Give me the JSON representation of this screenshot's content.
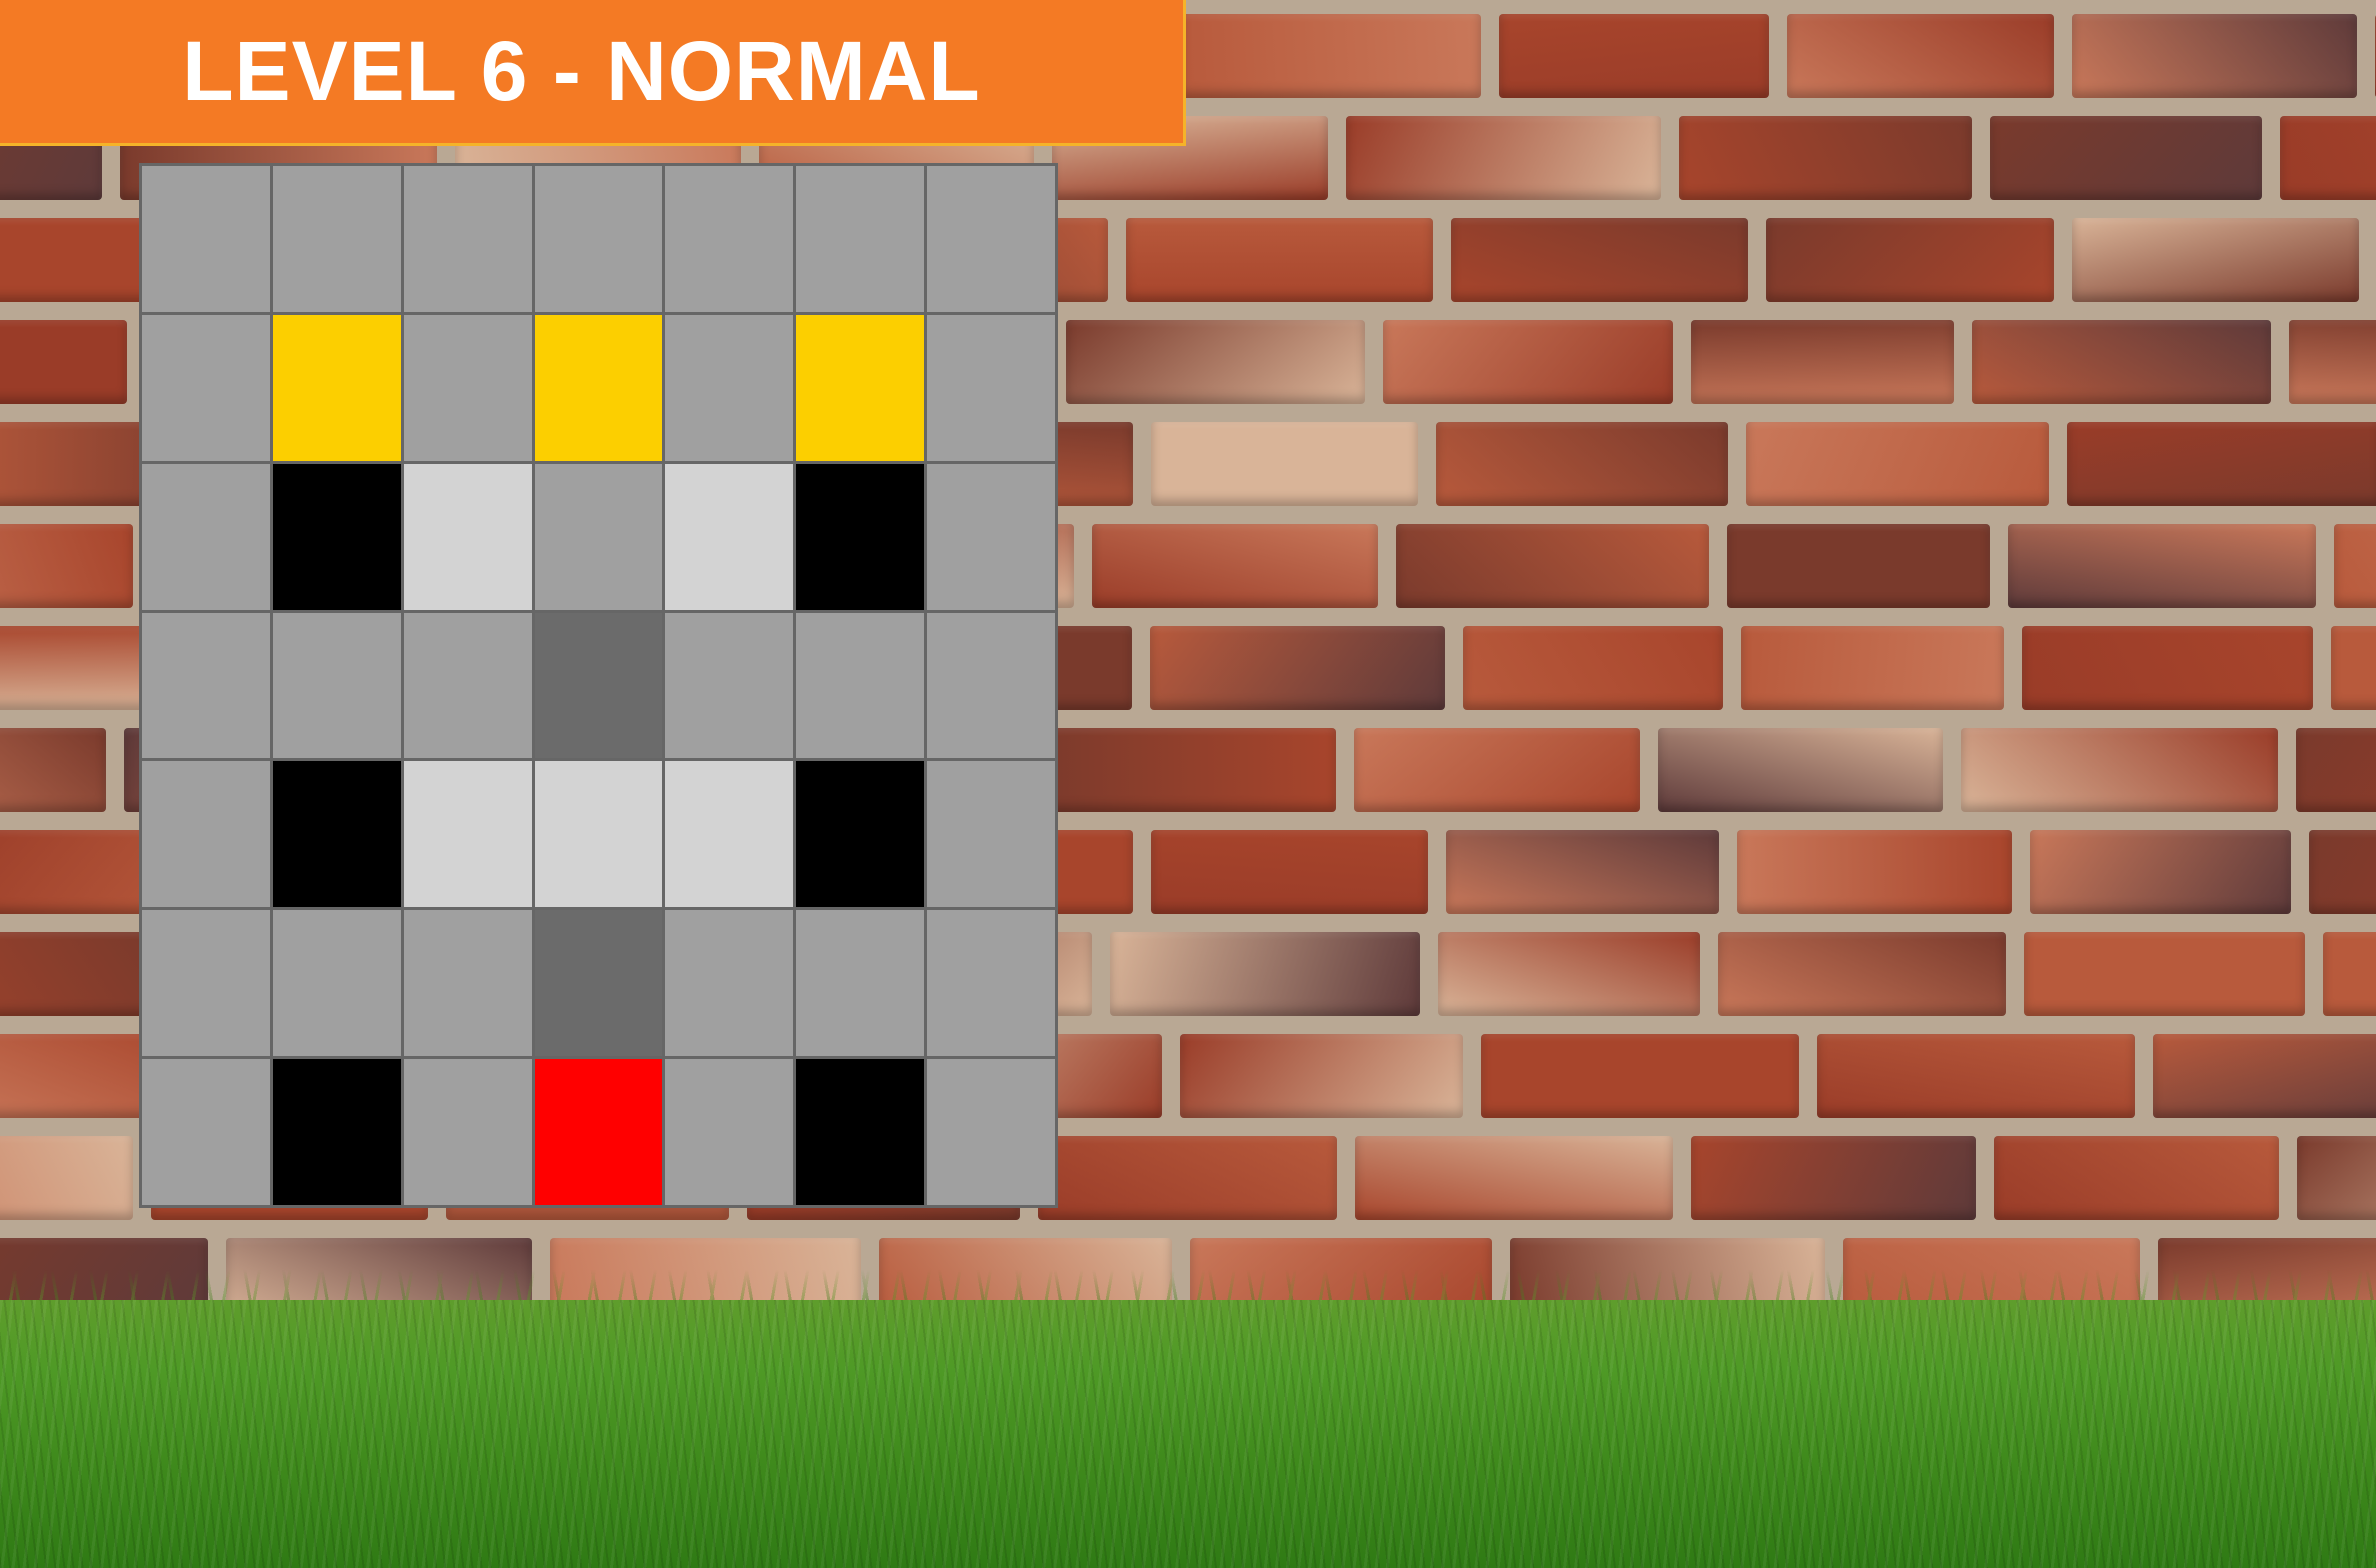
{
  "level": {
    "title": "LEVEL 6 - NORMAL",
    "banner_color": "#f47a24",
    "banner_border_color": "#f5b329"
  },
  "palette": {
    "gray": "#a0a0a0",
    "yellow": "#fccf00",
    "black": "#000000",
    "light": "#d3d3d3",
    "dark": "#6b6b6b",
    "red": "#ff0000"
  },
  "board": {
    "rows": 7,
    "cols": 7,
    "cells": [
      [
        "gray",
        "gray",
        "gray",
        "gray",
        "gray",
        "gray",
        "gray"
      ],
      [
        "gray",
        "yellow",
        "gray",
        "yellow",
        "gray",
        "yellow",
        "gray"
      ],
      [
        "gray",
        "black",
        "light",
        "gray",
        "light",
        "black",
        "gray"
      ],
      [
        "gray",
        "gray",
        "gray",
        "dark",
        "gray",
        "gray",
        "gray"
      ],
      [
        "gray",
        "black",
        "light",
        "light",
        "light",
        "black",
        "gray"
      ],
      [
        "gray",
        "gray",
        "gray",
        "dark",
        "gray",
        "gray",
        "gray"
      ],
      [
        "gray",
        "black",
        "gray",
        "red",
        "gray",
        "black",
        "gray"
      ]
    ]
  },
  "background": {
    "scene": "brick-wall-with-grass",
    "brick_colors": [
      "#a8452c",
      "#b85a3c",
      "#7a3a2c",
      "#c9785a",
      "#5e3a3a",
      "#d9b498",
      "#9a3c28"
    ]
  }
}
